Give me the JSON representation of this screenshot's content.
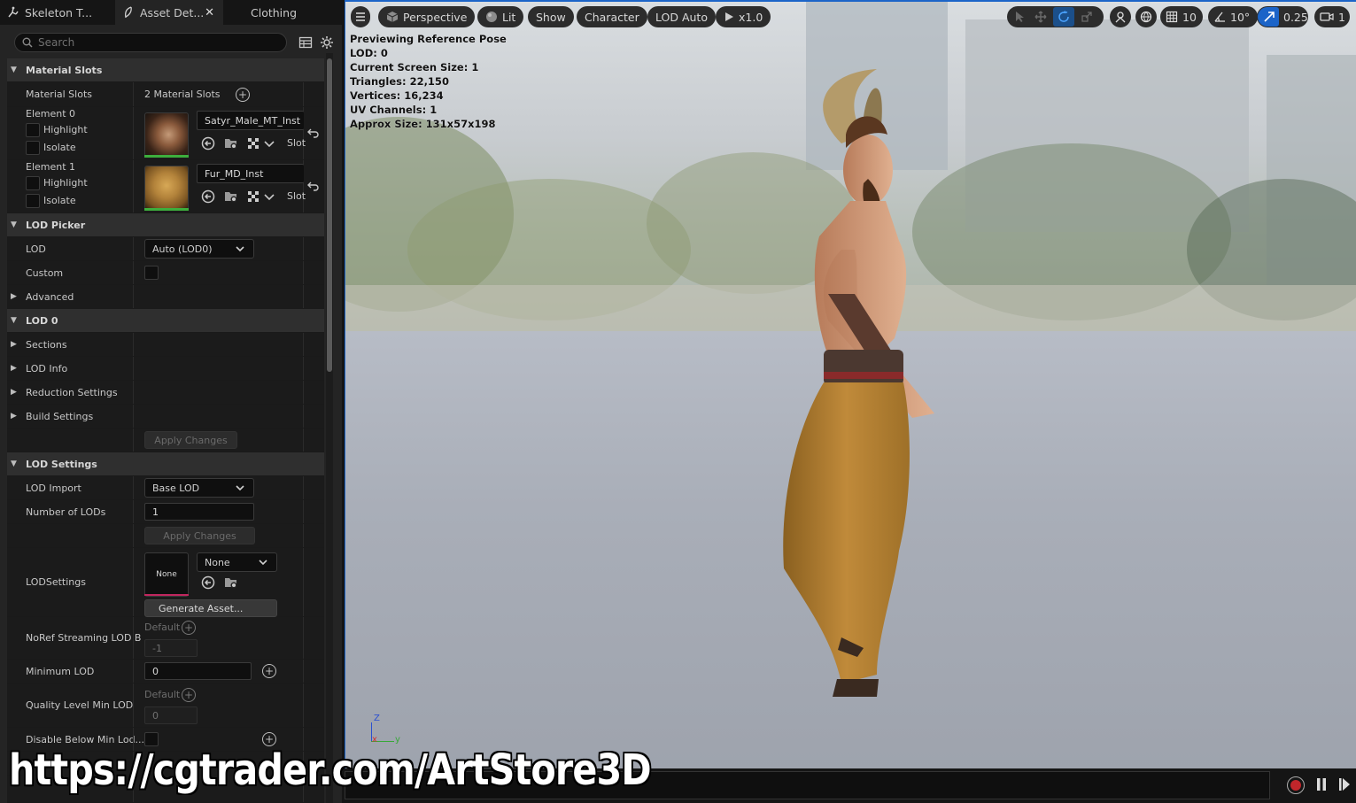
{
  "tabs": [
    {
      "label": "Skeleton T...",
      "icon": "skeleton-icon"
    },
    {
      "label": "Asset Det...",
      "icon": "feather-icon",
      "close": "✕"
    },
    {
      "label": "Clothing"
    }
  ],
  "search": {
    "placeholder": "Search"
  },
  "material_slots": {
    "header": "Material Slots",
    "label": "Material Slots",
    "count": "2 Material Slots",
    "elements": [
      {
        "label": "Element 0",
        "highlight": "Highlight",
        "isolate": "Isolate",
        "material": "Satyr_Male_MT_Inst",
        "slot": "Slot"
      },
      {
        "label": "Element 1",
        "highlight": "Highlight",
        "isolate": "Isolate",
        "material": "Fur_MD_Inst",
        "slot": "Slot"
      }
    ]
  },
  "lod_picker": {
    "header": "LOD Picker",
    "lod_label": "LOD",
    "lod_value": "Auto (LOD0)",
    "custom_label": "Custom",
    "advanced_label": "Advanced"
  },
  "lod0": {
    "header": "LOD 0",
    "sections": "Sections",
    "lod_info": "LOD Info",
    "reduction": "Reduction Settings",
    "build": "Build Settings",
    "apply": "Apply Changes"
  },
  "lod_settings": {
    "header": "LOD Settings",
    "import_label": "LOD Import",
    "import_value": "Base LOD",
    "num_label": "Number of LODs",
    "num_value": "1",
    "apply": "Apply Changes",
    "lodsettings_label": "LODSettings",
    "thumb_none": "None",
    "asset_value": "None",
    "generate": "Generate Asset...",
    "noref_label": "NoRef Streaming LOD B",
    "noref_default": "Default",
    "noref_value": "-1",
    "min_lod_label": "Minimum LOD",
    "min_lod_value": "0",
    "quality_label": "Quality Level Min LOD",
    "quality_default": "Default",
    "quality_value": "0",
    "disable_label": "Disable Below Min Lod..."
  },
  "viewport": {
    "buttons": {
      "perspective": "Perspective",
      "lit": "Lit",
      "show": "Show",
      "character": "Character",
      "lod": "LOD Auto",
      "play": "x1.0"
    },
    "grid_value": "10",
    "angle_value": "10°",
    "scale_value": "0.25",
    "camera_value": "1",
    "stats": [
      "Previewing Reference Pose",
      "LOD: 0",
      "Current Screen Size: 1",
      "Triangles: 22,150",
      "Vertices: 16,234",
      "UV Channels: 1",
      "Approx Size: 131x57x198"
    ],
    "axis": {
      "z": "Z",
      "x": "x",
      "y": "y"
    }
  },
  "watermark": "https://cgtrader.com/ArtStore3D",
  "colors": {
    "accent": "#1b64c8",
    "record": "#c0262b",
    "green_bar": "#3dae3d"
  }
}
